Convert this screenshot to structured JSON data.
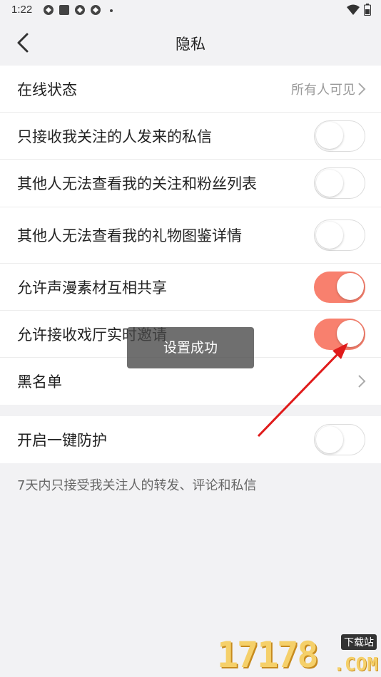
{
  "status_bar": {
    "time": "1:22"
  },
  "nav": {
    "title": "隐私"
  },
  "group1": {
    "rows": [
      {
        "label": "在线状态",
        "value": "所有人可见",
        "type": "link"
      },
      {
        "label": "只接收我关注的人发来的私信",
        "type": "toggle",
        "on": false
      },
      {
        "label": "其他人无法查看我的关注和粉丝列表",
        "type": "toggle",
        "on": false
      },
      {
        "label": "其他人无法查看我的礼物图鉴详情",
        "type": "toggle",
        "on": false
      },
      {
        "label": "允许声漫素材互相共享",
        "type": "toggle",
        "on": true
      },
      {
        "label": "允许接收戏厅实时邀请",
        "type": "toggle",
        "on": true
      },
      {
        "label": "黑名单",
        "type": "link"
      }
    ]
  },
  "group2": {
    "rows": [
      {
        "label": "开启一键防护",
        "type": "toggle",
        "on": false
      }
    ],
    "note": "7天内只接受我关注人的转发、评论和私信"
  },
  "toast": {
    "text": "设置成功"
  },
  "watermark": {
    "digits": "17178",
    "com": ".COM",
    "tag": "下载站"
  },
  "colors": {
    "accent": "#f8806e",
    "background": "#f2f2f4",
    "arrow": "#e01b1b"
  }
}
